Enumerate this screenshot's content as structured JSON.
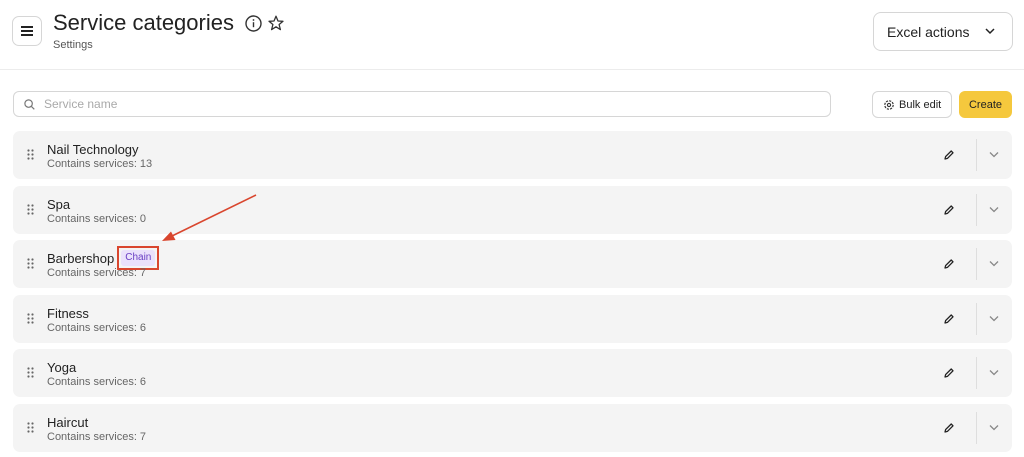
{
  "header": {
    "title": "Service categories",
    "subtitle": "Settings",
    "excel_actions_label": "Excel actions"
  },
  "toolbar": {
    "search_placeholder": "Service name",
    "bulk_edit_label": "Bulk edit",
    "create_label": "Create"
  },
  "categories": [
    {
      "name": "Nail Technology",
      "count_text": "Contains services: 13",
      "badge": ""
    },
    {
      "name": "Spa",
      "count_text": "Contains services: 0",
      "badge": ""
    },
    {
      "name": "Barbershop",
      "count_text": "Contains services: 7",
      "badge": "Chain"
    },
    {
      "name": "Fitness",
      "count_text": "Contains services: 6",
      "badge": ""
    },
    {
      "name": "Yoga",
      "count_text": "Contains services: 6",
      "badge": ""
    },
    {
      "name": "Haircut",
      "count_text": "Contains services: 7",
      "badge": ""
    }
  ],
  "colors": {
    "accent_create": "#f5c83d",
    "badge_bg": "#eae1fb",
    "badge_text": "#6a3fc4",
    "annotation": "#d9462e"
  },
  "icons": [
    "menu-icon",
    "info-icon",
    "star-icon",
    "chevron-down-icon",
    "search-icon",
    "gear-icon",
    "drag-handle-icon",
    "pencil-icon"
  ]
}
